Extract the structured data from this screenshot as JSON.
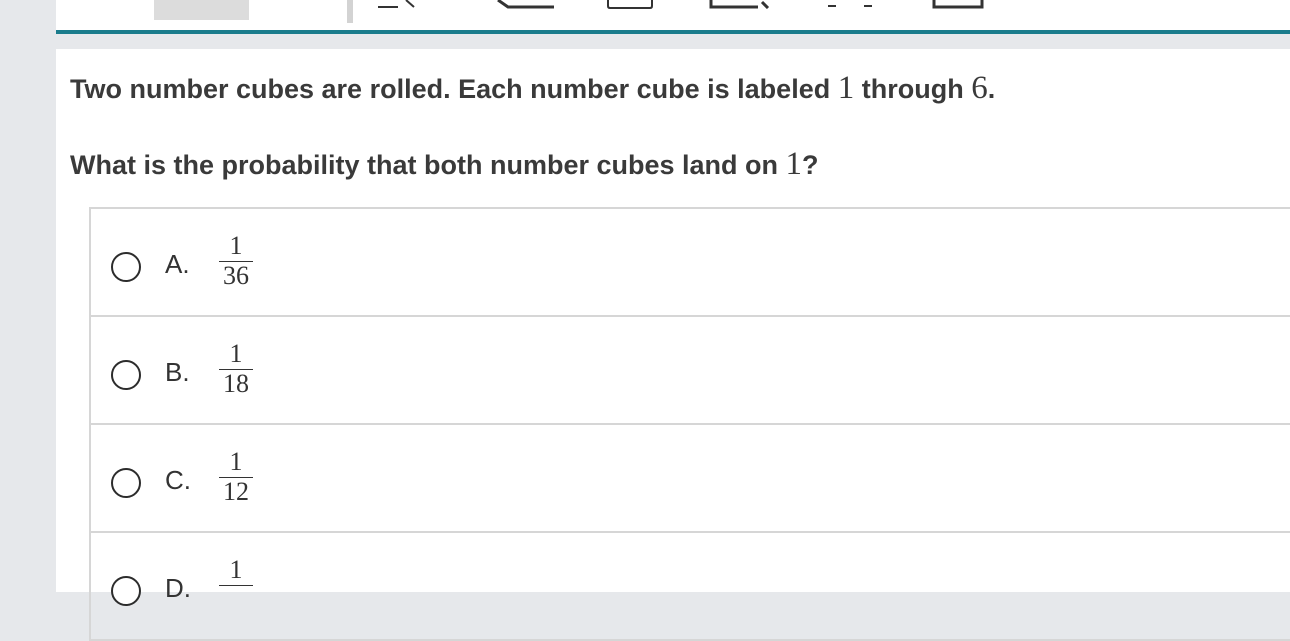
{
  "question": {
    "line1_text": "Two number cubes are rolled. Each number cube is labeled ",
    "line1_num1": "1",
    "line1_mid": " through ",
    "line1_num2": "6",
    "line1_end": ".",
    "line2_text": "What is the probability that both number cubes land on ",
    "line2_num": "1",
    "line2_end": "?"
  },
  "choices": [
    {
      "letter": "A.",
      "numerator": "1",
      "denominator": "36"
    },
    {
      "letter": "B.",
      "numerator": "1",
      "denominator": "18"
    },
    {
      "letter": "C.",
      "numerator": "1",
      "denominator": "12"
    },
    {
      "letter": "D.",
      "numerator": "1",
      "denominator": ""
    }
  ],
  "colors": {
    "accent": "#1a7c8c",
    "page_bg": "#e6e8eb"
  }
}
